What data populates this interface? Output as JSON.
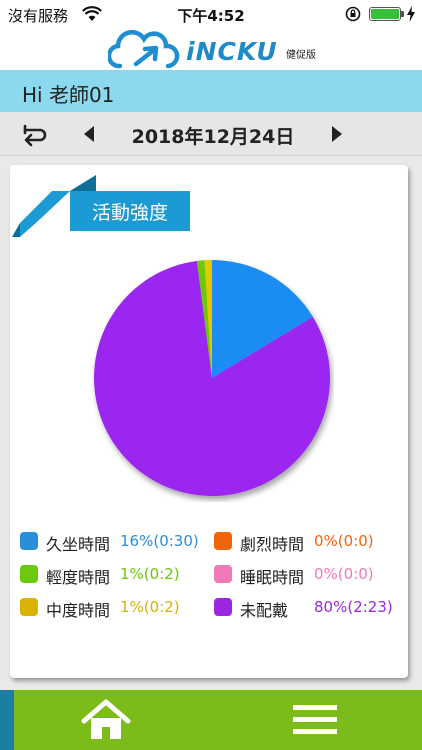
{
  "status_bar": {
    "carrier": "沒有服務",
    "time": "下午4:52"
  },
  "header": {
    "brand": "iNCKU",
    "edition": "健促版"
  },
  "greeting": "Hi 老師01",
  "date_nav": {
    "date": "2018年12月24日"
  },
  "card": {
    "title": "活動強度"
  },
  "chart_data": {
    "type": "pie",
    "slices": [
      {
        "name": "久坐時間",
        "value": 16,
        "label": "16%(0:30)",
        "color": "#1e8cf5"
      },
      {
        "name": "劇烈時間",
        "value": 0,
        "label": "0%(0:0)",
        "color": "#f55a0a"
      },
      {
        "name": "輕度時間",
        "value": 1,
        "label": "1%(0:2)",
        "color": "#6cc80a"
      },
      {
        "name": "睡眠時間",
        "value": 0,
        "label": "0%(0:0)",
        "color": "#f57ab4"
      },
      {
        "name": "中度時間",
        "value": 1,
        "label": "1%(0:2)",
        "color": "#e6c800"
      },
      {
        "name": "未配戴",
        "value": 80,
        "label": "80%(2:23)",
        "color": "#9b28f0"
      }
    ],
    "draw_order": [
      "久坐時間",
      "未配戴",
      "輕度時間",
      "中度時間"
    ]
  },
  "legend_colors": {
    "久坐時間": "#2a8fd8",
    "劇烈時間": "#f0640a",
    "輕度時間": "#6cc80a",
    "睡眠時間": "#f07ab8",
    "中度時間": "#d8b400",
    "未配戴": "#9b28e0"
  },
  "colors": {
    "greeting_bg": "#8ad9ef",
    "ribbon": "#1c9ad3",
    "bottom_bar": "#7bbc1b",
    "bottom_accent": "#1b7fa4"
  },
  "icons": {
    "back": "return-arrow-icon",
    "prev": "triangle-left-icon",
    "next": "triangle-right-icon",
    "home": "home-icon",
    "menu": "hamburger-menu-icon"
  }
}
